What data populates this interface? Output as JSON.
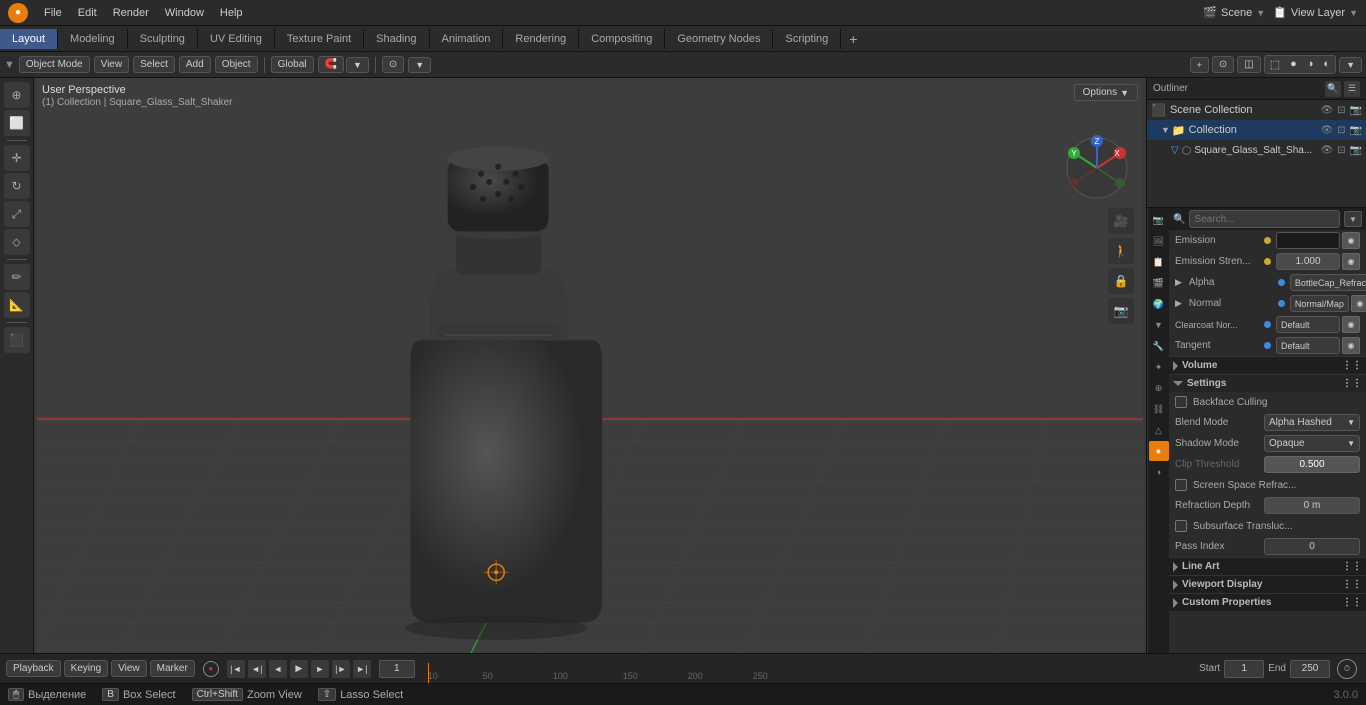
{
  "app": {
    "title": "Blender",
    "version": "3.0.0"
  },
  "menu": {
    "items": [
      "File",
      "Edit",
      "Render",
      "Window",
      "Help"
    ]
  },
  "workspace_tabs": {
    "tabs": [
      "Layout",
      "Modeling",
      "Sculpting",
      "UV Editing",
      "Texture Paint",
      "Shading",
      "Animation",
      "Rendering",
      "Compositing",
      "Geometry Nodes",
      "Scripting"
    ]
  },
  "active_workspace": "Layout",
  "toolbar2": {
    "mode": "Object Mode",
    "view": "View",
    "select": "Select",
    "add": "Add",
    "object": "Object",
    "transform": "Global",
    "pivot": "Individual Origins"
  },
  "viewport": {
    "label_line1": "User Perspective",
    "label_line2": "(1) Collection | Square_Glass_Salt_Shaker",
    "options_btn": "Options"
  },
  "outliner": {
    "title": "Outliner",
    "scene_collection": "Scene Collection",
    "collection": "Collection",
    "object": "Square_Glass_Salt_Sha..."
  },
  "properties": {
    "search_placeholder": "Search...",
    "sections": {
      "emission": {
        "label": "Emission",
        "strength_label": "Emission Stren...",
        "strength_value": "1.000",
        "alpha_label": "Alpha",
        "alpha_value": "BottleCap_Refrac...",
        "normal_label": "Normal",
        "normal_value": "Normal/Map",
        "clearcoat_label": "Clearcoat Nor...",
        "clearcoat_value": "Default",
        "tangent_label": "Tangent",
        "tangent_value": "Default"
      },
      "volume": {
        "label": "Volume"
      },
      "settings": {
        "label": "Settings",
        "backface_culling": "Backface Culling",
        "blend_mode_label": "Blend Mode",
        "blend_mode_value": "Alpha Hashed",
        "shadow_mode_label": "Shadow Mode",
        "shadow_mode_value": "Opaque",
        "clip_threshold_label": "Clip Threshold",
        "clip_threshold_value": "0.500",
        "screen_space_refrac": "Screen Space Refrac...",
        "refraction_depth_label": "Refraction Depth",
        "refraction_depth_value": "0 m",
        "subsurface_transluc": "Subsurface Transluc...",
        "pass_index_label": "Pass Index",
        "pass_index_value": "0"
      },
      "line_art": {
        "label": "Line Art"
      },
      "viewport_display": {
        "label": "Viewport Display"
      },
      "custom_properties": {
        "label": "Custom Properties"
      }
    }
  },
  "timeline": {
    "playback": "Playback",
    "keying": "Keying",
    "view": "View",
    "marker": "Marker",
    "current_frame": "1",
    "start_label": "Start",
    "start_frame": "1",
    "end_label": "End",
    "end_frame": "250",
    "ticks": [
      "10",
      "50",
      "100",
      "150",
      "200",
      "250"
    ]
  },
  "status_bar": {
    "selection_label": "Выделение",
    "box_select": "Box Select",
    "lasso_select": "Lasso Select",
    "zoom_view": "Zoom View"
  },
  "prop_icons": [
    {
      "name": "render-icon",
      "symbol": "📷",
      "active": false
    },
    {
      "name": "output-icon",
      "symbol": "🖼",
      "active": false
    },
    {
      "name": "view-layer-icon",
      "symbol": "📋",
      "active": false
    },
    {
      "name": "scene-icon",
      "symbol": "🎬",
      "active": false
    },
    {
      "name": "world-icon",
      "symbol": "🌍",
      "active": false
    },
    {
      "name": "object-icon",
      "symbol": "▼",
      "active": false
    },
    {
      "name": "modifier-icon",
      "symbol": "🔧",
      "active": false
    },
    {
      "name": "particles-icon",
      "symbol": "✦",
      "active": false
    },
    {
      "name": "physics-icon",
      "symbol": "⊕",
      "active": false
    },
    {
      "name": "constraints-icon",
      "symbol": "⛓",
      "active": false
    },
    {
      "name": "object-data-icon",
      "symbol": "△",
      "active": false
    },
    {
      "name": "material-icon",
      "symbol": "●",
      "active": true
    },
    {
      "name": "shading-icon",
      "symbol": "◑",
      "active": false
    }
  ]
}
